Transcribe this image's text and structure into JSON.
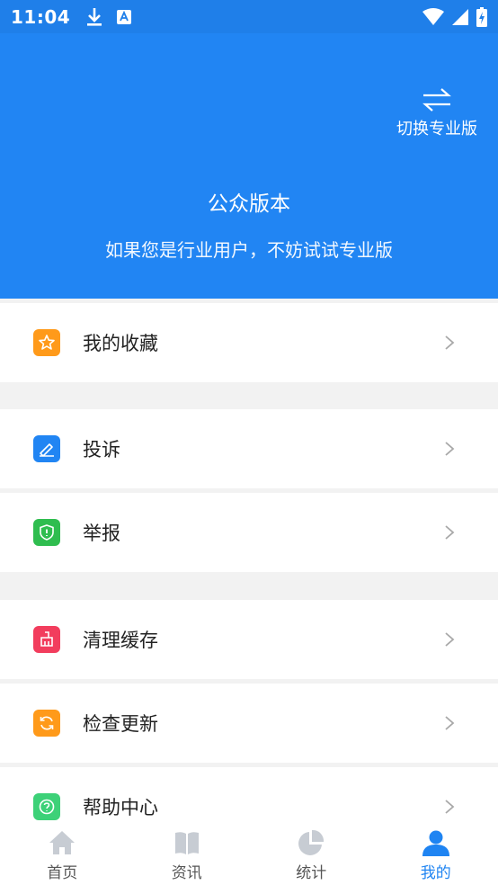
{
  "status_bar": {
    "time": "11:04"
  },
  "header": {
    "switch_label": "切换专业版",
    "title": "公众版本",
    "subtitle": "如果您是行业用户，不妨试试专业版"
  },
  "menu": [
    {
      "label": "我的收藏",
      "icon": "star-icon",
      "color": "#ff9a1a"
    },
    {
      "label": "投诉",
      "icon": "complaint-icon",
      "color": "#2185f3"
    },
    {
      "label": "举报",
      "icon": "shield-icon",
      "color": "#2fbd4f"
    },
    {
      "label": "清理缓存",
      "icon": "broom-icon",
      "color": "#f23d5d"
    },
    {
      "label": "检查更新",
      "icon": "refresh-icon",
      "color": "#ff9a1a"
    },
    {
      "label": "帮助中心",
      "icon": "help-icon",
      "color": "#3dd178"
    }
  ],
  "tabs": [
    {
      "label": "首页",
      "icon": "home-icon",
      "active": false
    },
    {
      "label": "资讯",
      "icon": "book-icon",
      "active": false
    },
    {
      "label": "统计",
      "icon": "pie-chart-icon",
      "active": false
    },
    {
      "label": "我的",
      "icon": "user-icon",
      "active": true
    }
  ],
  "colors": {
    "primary": "#2185f3",
    "inactive_tab": "#c7ccd3"
  }
}
